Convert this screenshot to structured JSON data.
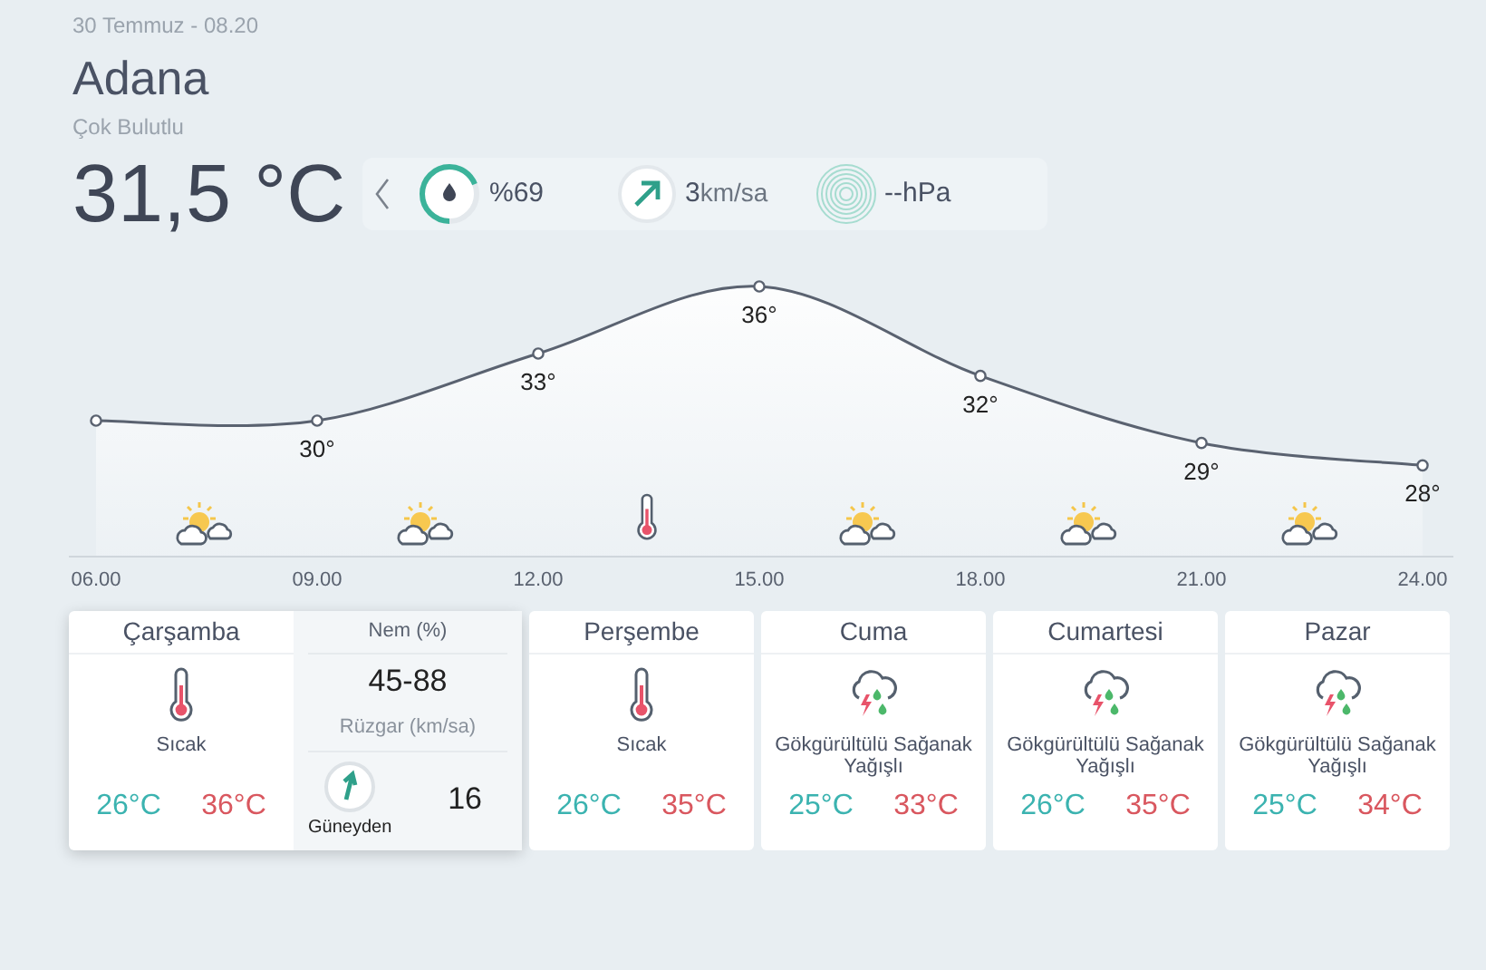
{
  "date": "30 Temmuz - 08.20",
  "city": "Adana",
  "condition": "Çok Bulutlu",
  "temperature": "31,5 °C",
  "stats": [
    {
      "kind": "humidity",
      "value": "%69",
      "level": 0.69
    },
    {
      "kind": "wind",
      "value": "3",
      "unit": "km/sa"
    },
    {
      "kind": "pressure",
      "value": "--hPa"
    }
  ],
  "hourly": {
    "chart_data": {
      "type": "area",
      "categories": [
        "06.00",
        "09.00",
        "12.00",
        "15.00",
        "18.00",
        "21.00",
        "24.00"
      ],
      "series": [
        {
          "color": "#5a6270",
          "marker": "o",
          "values": [
            30,
            30,
            33,
            36,
            32,
            29,
            28
          ],
          "value_labels": [
            null,
            "30°",
            "33°",
            "36°",
            "32°",
            "29°",
            "28°"
          ]
        }
      ],
      "data_labels": true
    },
    "icons": [
      {
        "kind": "partly_cloudy"
      },
      {
        "kind": "partly_cloudy"
      },
      {
        "kind": "hot"
      },
      {
        "kind": "partly_cloudy"
      },
      {
        "kind": "partly_cloudy"
      },
      {
        "kind": "partly_cloudy"
      }
    ]
  },
  "days": [
    {
      "name": "Çarşamba",
      "kind": "hot",
      "condition": "Sıcak",
      "low": "26°C",
      "high": "36°C",
      "selected": true,
      "details": {
        "humidity_label": "Nem (%)",
        "humidity": "45-88",
        "wind_label": "Rüzgar (km/sa)",
        "wind_direction": "Güneyden",
        "wind_speed": "16"
      }
    },
    {
      "name": "Perşembe",
      "kind": "hot",
      "condition": "Sıcak",
      "low": "26°C",
      "high": "35°C",
      "selected": false
    },
    {
      "name": "Cuma",
      "kind": "storm",
      "condition": "Gökgürültülü Sağanak Yağışlı",
      "low": "25°C",
      "high": "33°C",
      "selected": false
    },
    {
      "name": "Cumartesi",
      "kind": "storm",
      "condition": "Gökgürültülü Sağanak Yağışlı",
      "low": "26°C",
      "high": "35°C",
      "selected": false
    },
    {
      "name": "Pazar",
      "kind": "storm",
      "condition": "Gökgürültülü Sağanak Yağışlı",
      "low": "25°C",
      "high": "34°C",
      "selected": false
    }
  ]
}
